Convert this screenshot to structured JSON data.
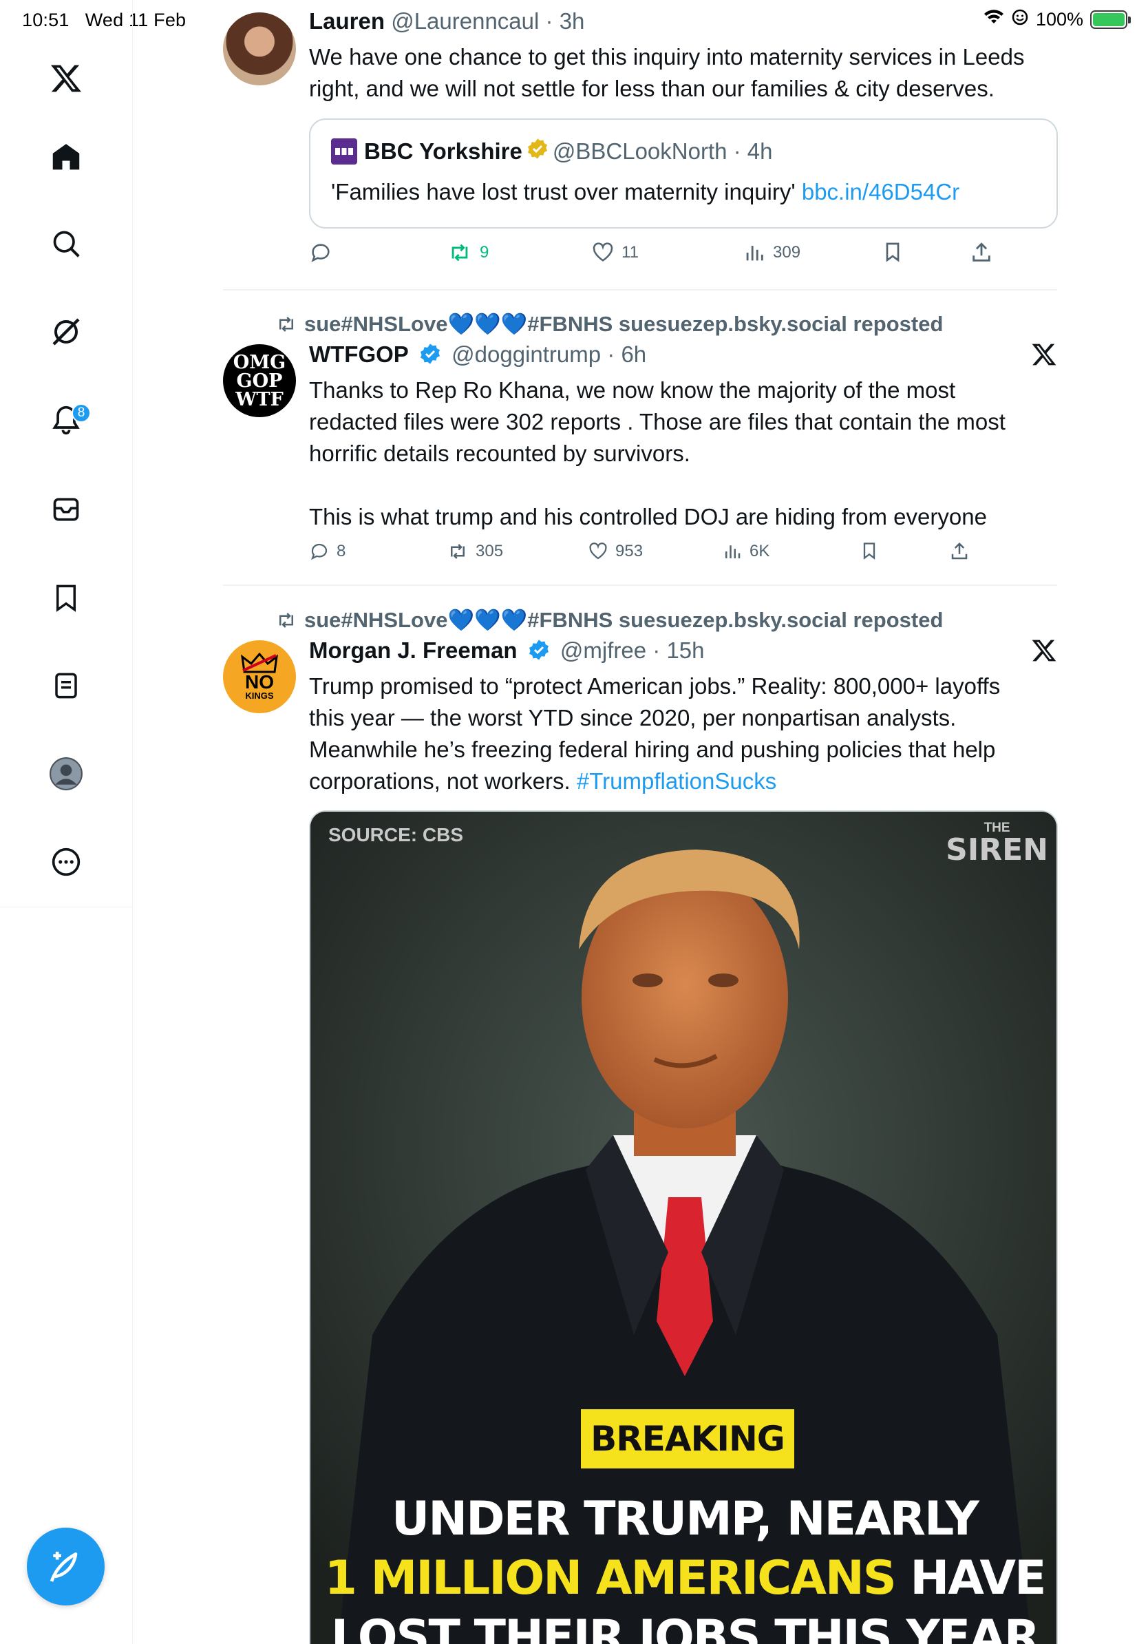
{
  "status_bar": {
    "time": "10:51",
    "date": "Wed 11 Feb",
    "battery": "100%"
  },
  "sidebar": {
    "items": [
      {
        "name": "x-logo-icon"
      },
      {
        "name": "home-icon"
      },
      {
        "name": "search-icon"
      },
      {
        "name": "grok-icon"
      },
      {
        "name": "notifications-icon",
        "badge": "8"
      },
      {
        "name": "messages-icon"
      },
      {
        "name": "bookmarks-icon"
      },
      {
        "name": "lists-icon"
      },
      {
        "name": "profile-icon"
      },
      {
        "name": "more-icon"
      }
    ]
  },
  "tweets": [
    {
      "name": "Lauren",
      "handle": "@Laurenncaul",
      "time": "3h",
      "text_line1": "We have one chance to get this inquiry into maternity services in Leeds",
      "text_line2": "right, and we will not settle for less than our families & city deserves.",
      "quote": {
        "name": "BBC Yorkshire",
        "handle": "@BBCLookNorth",
        "time": "4h",
        "text": "'Families have lost trust over maternity inquiry'",
        "link": "bbc.in/46D54Cr"
      },
      "stats": {
        "replies": "",
        "reposts": "9",
        "likes": "11",
        "views": "309"
      }
    },
    {
      "repost_by": "sue#NHSLove💙💙💙#FBNHS suesuezep.bsky.social reposted",
      "name": "WTFGOP",
      "handle": "@doggintrump",
      "time": "6h",
      "avatar_text": [
        "OMG",
        "GOP",
        "WTF"
      ],
      "text_line1": "Thanks to Rep Ro Khana, we now know the majority of the most",
      "text_line2": "redacted files were 302 reports . Those are files that contain the most",
      "text_line3": "horrific details recounted by survivors.",
      "text_line4": "This is what trump and his controlled DOJ are hiding from everyone",
      "stats": {
        "replies": "8",
        "reposts": "305",
        "likes": "953",
        "views": "6K"
      }
    },
    {
      "repost_by": "sue#NHSLove💙💙💙#FBNHS suesuezep.bsky.social reposted",
      "name": "Morgan J. Freeman",
      "handle": "@mjfree",
      "time": "15h",
      "avatar_text": [
        "NO",
        "KINGS"
      ],
      "text_line1": "Trump promised to “protect American jobs.” Reality: 800,000+ layoffs",
      "text_line2": "this year — the worst YTD since 2020, per nonpartisan analysts.",
      "text_line3": "Meanwhile he’s freezing federal hiring and pushing policies that help",
      "text_line4": "corporations, not workers.",
      "hashtag": "#TrumpflationSucks",
      "media": {
        "source": "SOURCE: CBS",
        "brand_top": "THE",
        "brand": "SIREN",
        "breaking": "BREAKING",
        "headline1": "UNDER TRUMP, NEARLY",
        "headline2_yellow": "1 MILLION AMERICANS",
        "headline2_white": " HAVE",
        "headline3": "LOST THEIR JOBS THIS YEAR"
      }
    }
  ],
  "colors": {
    "accent": "#1d9bf0",
    "repost_green": "#00ba7c",
    "text": "#0f1419",
    "muted": "#536471"
  }
}
